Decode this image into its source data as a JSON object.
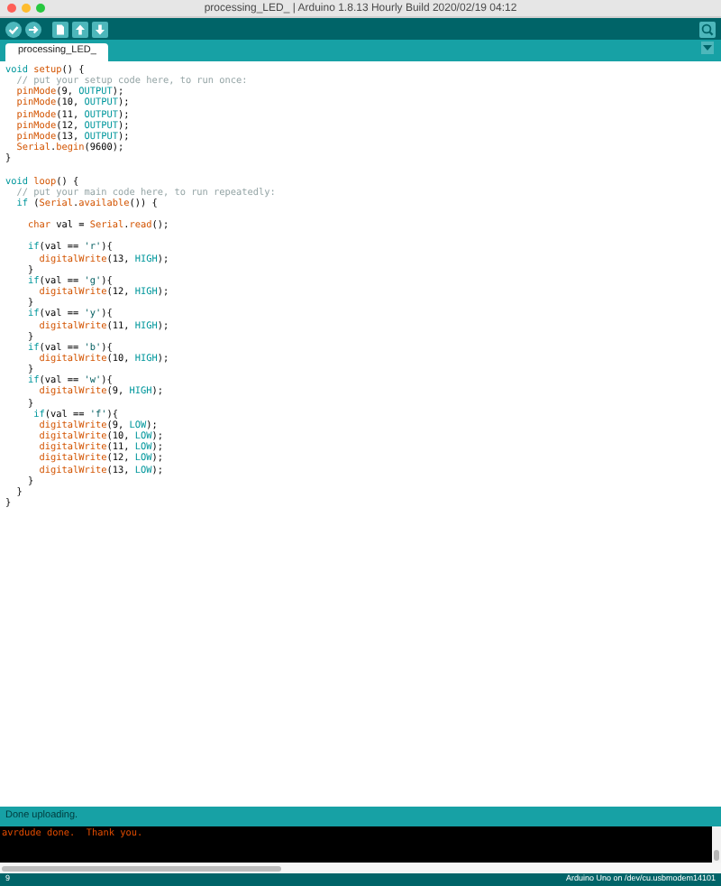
{
  "window": {
    "title": "processing_LED_ | Arduino 1.8.13 Hourly Build 2020/02/19 04:12"
  },
  "tabs": [
    {
      "label": "processing_LED_",
      "selected": true
    }
  ],
  "editor": {
    "lines": [
      {
        "tokens": [
          {
            "kind": "keyword",
            "text": "void"
          },
          {
            "kind": "function",
            "text": " setup"
          },
          {
            "kind": "plain",
            "text": "() {"
          }
        ]
      },
      {
        "tokens": [
          {
            "kind": "comment",
            "text": "  // put your setup code here, to run once:"
          }
        ]
      },
      {
        "tokens": [
          {
            "kind": "function",
            "text": "  pinMode"
          },
          {
            "kind": "plain",
            "text": "(9, "
          },
          {
            "kind": "constant",
            "text": "OUTPUT"
          },
          {
            "kind": "plain",
            "text": ");"
          }
        ]
      },
      {
        "tokens": [
          {
            "kind": "function",
            "text": "  pinMode"
          },
          {
            "kind": "plain",
            "text": "(10, "
          },
          {
            "kind": "constant",
            "text": "OUTPUT"
          },
          {
            "kind": "plain",
            "text": ");"
          }
        ]
      },
      {
        "tokens": [
          {
            "kind": "function",
            "text": "  pinMode"
          },
          {
            "kind": "plain",
            "text": "(11, "
          },
          {
            "kind": "constant",
            "text": "OUTPUT"
          },
          {
            "kind": "plain",
            "text": ");"
          }
        ]
      },
      {
        "tokens": [
          {
            "kind": "function",
            "text": "  pinMode"
          },
          {
            "kind": "plain",
            "text": "(12, "
          },
          {
            "kind": "constant",
            "text": "OUTPUT"
          },
          {
            "kind": "plain",
            "text": ");"
          }
        ]
      },
      {
        "tokens": [
          {
            "kind": "function",
            "text": "  pinMode"
          },
          {
            "kind": "plain",
            "text": "(13, "
          },
          {
            "kind": "constant",
            "text": "OUTPUT"
          },
          {
            "kind": "plain",
            "text": ");"
          }
        ]
      },
      {
        "tokens": [
          {
            "kind": "function",
            "text": "  Serial"
          },
          {
            "kind": "plain",
            "text": "."
          },
          {
            "kind": "function",
            "text": "begin"
          },
          {
            "kind": "plain",
            "text": "(9600);"
          }
        ]
      },
      {
        "tokens": [
          {
            "kind": "plain",
            "text": "}"
          }
        ]
      },
      {
        "kind": "blank"
      },
      {
        "tokens": [
          {
            "kind": "keyword",
            "text": "void"
          },
          {
            "kind": "function",
            "text": " loop"
          },
          {
            "kind": "plain",
            "text": "() {"
          }
        ]
      },
      {
        "tokens": [
          {
            "kind": "comment",
            "text": "  // put your main code here, to run repeatedly:"
          }
        ]
      },
      {
        "tokens": [
          {
            "kind": "keyword",
            "text": "  if"
          },
          {
            "kind": "plain",
            "text": " ("
          },
          {
            "kind": "function",
            "text": "Serial"
          },
          {
            "kind": "plain",
            "text": "."
          },
          {
            "kind": "function",
            "text": "available"
          },
          {
            "kind": "plain",
            "text": "()) {"
          }
        ]
      },
      {
        "kind": "blank"
      },
      {
        "tokens": [
          {
            "kind": "function",
            "text": "    char"
          },
          {
            "kind": "plain",
            "text": " val = "
          },
          {
            "kind": "function",
            "text": "Serial"
          },
          {
            "kind": "plain",
            "text": "."
          },
          {
            "kind": "function",
            "text": "read"
          },
          {
            "kind": "plain",
            "text": "();"
          }
        ]
      },
      {
        "kind": "blank"
      },
      {
        "tokens": [
          {
            "kind": "keyword",
            "text": "    if"
          },
          {
            "kind": "plain",
            "text": "(val == "
          },
          {
            "kind": "string",
            "text": "'r'"
          },
          {
            "kind": "plain",
            "text": "){"
          }
        ]
      },
      {
        "tokens": [
          {
            "kind": "function",
            "text": "      digitalWrite"
          },
          {
            "kind": "plain",
            "text": "(13, "
          },
          {
            "kind": "constant",
            "text": "HIGH"
          },
          {
            "kind": "plain",
            "text": ");"
          }
        ]
      },
      {
        "tokens": [
          {
            "kind": "plain",
            "text": "    }"
          }
        ]
      },
      {
        "tokens": [
          {
            "kind": "keyword",
            "text": "    if"
          },
          {
            "kind": "plain",
            "text": "(val == "
          },
          {
            "kind": "string",
            "text": "'g'"
          },
          {
            "kind": "plain",
            "text": "){"
          }
        ]
      },
      {
        "tokens": [
          {
            "kind": "function",
            "text": "      digitalWrite"
          },
          {
            "kind": "plain",
            "text": "(12, "
          },
          {
            "kind": "constant",
            "text": "HIGH"
          },
          {
            "kind": "plain",
            "text": ");"
          }
        ]
      },
      {
        "tokens": [
          {
            "kind": "plain",
            "text": "    }"
          }
        ]
      },
      {
        "tokens": [
          {
            "kind": "keyword",
            "text": "    if"
          },
          {
            "kind": "plain",
            "text": "(val == "
          },
          {
            "kind": "string",
            "text": "'y'"
          },
          {
            "kind": "plain",
            "text": "){"
          }
        ]
      },
      {
        "tokens": [
          {
            "kind": "function",
            "text": "      digitalWrite"
          },
          {
            "kind": "plain",
            "text": "(11, "
          },
          {
            "kind": "constant",
            "text": "HIGH"
          },
          {
            "kind": "plain",
            "text": ");"
          }
        ]
      },
      {
        "tokens": [
          {
            "kind": "plain",
            "text": "    }"
          }
        ]
      },
      {
        "tokens": [
          {
            "kind": "keyword",
            "text": "    if"
          },
          {
            "kind": "plain",
            "text": "(val == "
          },
          {
            "kind": "string",
            "text": "'b'"
          },
          {
            "kind": "plain",
            "text": "){"
          }
        ]
      },
      {
        "tokens": [
          {
            "kind": "function",
            "text": "      digitalWrite"
          },
          {
            "kind": "plain",
            "text": "(10, "
          },
          {
            "kind": "constant",
            "text": "HIGH"
          },
          {
            "kind": "plain",
            "text": ");"
          }
        ]
      },
      {
        "tokens": [
          {
            "kind": "plain",
            "text": "    }"
          }
        ]
      },
      {
        "tokens": [
          {
            "kind": "keyword",
            "text": "    if"
          },
          {
            "kind": "plain",
            "text": "(val == "
          },
          {
            "kind": "string",
            "text": "'w'"
          },
          {
            "kind": "plain",
            "text": "){"
          }
        ]
      },
      {
        "tokens": [
          {
            "kind": "function",
            "text": "      digitalWrite"
          },
          {
            "kind": "plain",
            "text": "(9, "
          },
          {
            "kind": "constant",
            "text": "HIGH"
          },
          {
            "kind": "plain",
            "text": ");"
          }
        ]
      },
      {
        "tokens": [
          {
            "kind": "plain",
            "text": "    }"
          }
        ]
      },
      {
        "tokens": [
          {
            "kind": "keyword",
            "text": "     if"
          },
          {
            "kind": "plain",
            "text": "(val == "
          },
          {
            "kind": "string",
            "text": "'f'"
          },
          {
            "kind": "plain",
            "text": "){"
          }
        ]
      },
      {
        "tokens": [
          {
            "kind": "function",
            "text": "      digitalWrite"
          },
          {
            "kind": "plain",
            "text": "(9, "
          },
          {
            "kind": "constant",
            "text": "LOW"
          },
          {
            "kind": "plain",
            "text": ");"
          }
        ]
      },
      {
        "tokens": [
          {
            "kind": "function",
            "text": "      digitalWrite"
          },
          {
            "kind": "plain",
            "text": "(10, "
          },
          {
            "kind": "constant",
            "text": "LOW"
          },
          {
            "kind": "plain",
            "text": ");"
          }
        ]
      },
      {
        "tokens": [
          {
            "kind": "function",
            "text": "      digitalWrite"
          },
          {
            "kind": "plain",
            "text": "(11, "
          },
          {
            "kind": "constant",
            "text": "LOW"
          },
          {
            "kind": "plain",
            "text": ");"
          }
        ]
      },
      {
        "tokens": [
          {
            "kind": "function",
            "text": "      digitalWrite"
          },
          {
            "kind": "plain",
            "text": "(12, "
          },
          {
            "kind": "constant",
            "text": "LOW"
          },
          {
            "kind": "plain",
            "text": ");"
          }
        ]
      },
      {
        "tokens": [
          {
            "kind": "function",
            "text": "      digitalWrite"
          },
          {
            "kind": "plain",
            "text": "(13, "
          },
          {
            "kind": "constant",
            "text": "LOW"
          },
          {
            "kind": "plain",
            "text": ");"
          }
        ]
      },
      {
        "tokens": [
          {
            "kind": "plain",
            "text": "    }"
          }
        ]
      },
      {
        "tokens": [
          {
            "kind": "plain",
            "text": "  }"
          }
        ]
      },
      {
        "tokens": [
          {
            "kind": "plain",
            "text": "}"
          }
        ]
      }
    ]
  },
  "status": {
    "message": "Done uploading."
  },
  "console": {
    "lines": [
      "avrdude done.  Thank you."
    ]
  },
  "status_bar": {
    "line_number": "9",
    "board": "Arduino Uno on /dev/cu.usbmodem14101"
  }
}
